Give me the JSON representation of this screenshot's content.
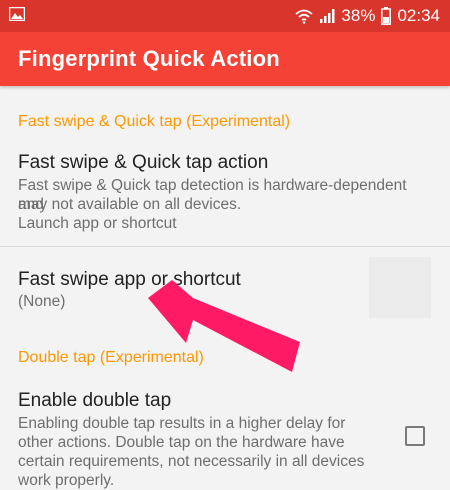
{
  "status_bar": {
    "battery_percent": "38%",
    "time": "02:34",
    "icons": [
      "image-icon",
      "wifi-icon",
      "signal-icon",
      "battery-icon"
    ]
  },
  "app_bar": {
    "title": "Fingerprint Quick Action"
  },
  "sections": [
    {
      "header": "Fast swipe & Quick tap (Experimental)",
      "items": [
        {
          "title": "Fast swipe & Quick tap action",
          "summary_lines": [
            "Fast swipe & Quick tap detection is hardware-dependent and",
            "may not available on all devices.",
            "Launch app or shortcut"
          ]
        },
        {
          "title": "Fast swipe app or shortcut",
          "summary": "(None)"
        }
      ]
    },
    {
      "header": "Double tap (Experimental)",
      "items": [
        {
          "title": "Enable double tap",
          "summary_lines": [
            "Enabling double tap results in a higher delay for",
            "other actions. Double tap on the hardware have",
            "certain requirements, not necessarily in all devices",
            "work properly."
          ],
          "checked": false
        }
      ]
    }
  ],
  "colors": {
    "status_bar": "#d8362d",
    "app_bar": "#f44336",
    "section_header": "#ff9800",
    "annotation_arrow": "#ff1a66"
  }
}
